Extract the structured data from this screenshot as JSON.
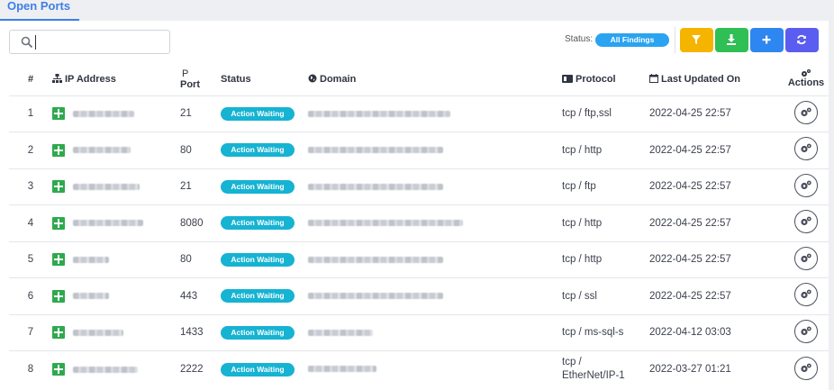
{
  "tab": {
    "label": "Open Ports"
  },
  "search": {
    "placeholder": ""
  },
  "status_filter": {
    "label": "Status:",
    "value": "All Findings"
  },
  "colors": {
    "accent": "#3d7fe6",
    "filter": "#f5b400",
    "download": "#2fbf55",
    "add": "#2e86f0",
    "refresh": "#5a5df0",
    "badge": "#16b3d2",
    "plus": "#2fa94e"
  },
  "toolbar": {
    "filter_icon": "filter-icon",
    "download_icon": "download-icon",
    "add_icon": "plus-icon",
    "refresh_icon": "refresh-icon"
  },
  "columns": {
    "num": "#",
    "ip": "IP Address",
    "port_glyph": "P",
    "port": "Port",
    "status": "Status",
    "domain": "Domain",
    "protocol": "Protocol",
    "updated": "Last Updated On",
    "actions": "Actions"
  },
  "rows": [
    {
      "num": "1",
      "port": "21",
      "status": "Action Waiting",
      "protocol": "tcp / ftp,ssl",
      "updated": "2022-04-25 22:57"
    },
    {
      "num": "2",
      "port": "80",
      "status": "Action Waiting",
      "protocol": "tcp / http",
      "updated": "2022-04-25 22:57"
    },
    {
      "num": "3",
      "port": "21",
      "status": "Action Waiting",
      "protocol": "tcp / ftp",
      "updated": "2022-04-25 22:57"
    },
    {
      "num": "4",
      "port": "8080",
      "status": "Action Waiting",
      "protocol": "tcp / http",
      "updated": "2022-04-25 22:57"
    },
    {
      "num": "5",
      "port": "80",
      "status": "Action Waiting",
      "protocol": "tcp / http",
      "updated": "2022-04-25 22:57"
    },
    {
      "num": "6",
      "port": "443",
      "status": "Action Waiting",
      "protocol": "tcp / ssl",
      "updated": "2022-04-25 22:57"
    },
    {
      "num": "7",
      "port": "1433",
      "status": "Action Waiting",
      "protocol": "tcp / ms-sql-s",
      "updated": "2022-04-12 03:03"
    },
    {
      "num": "8",
      "port": "2222",
      "status": "Action Waiting",
      "protocol_line1": "tcp /",
      "protocol_line2": "EtherNet/IP-1",
      "updated": "2022-03-27 01:21"
    }
  ]
}
